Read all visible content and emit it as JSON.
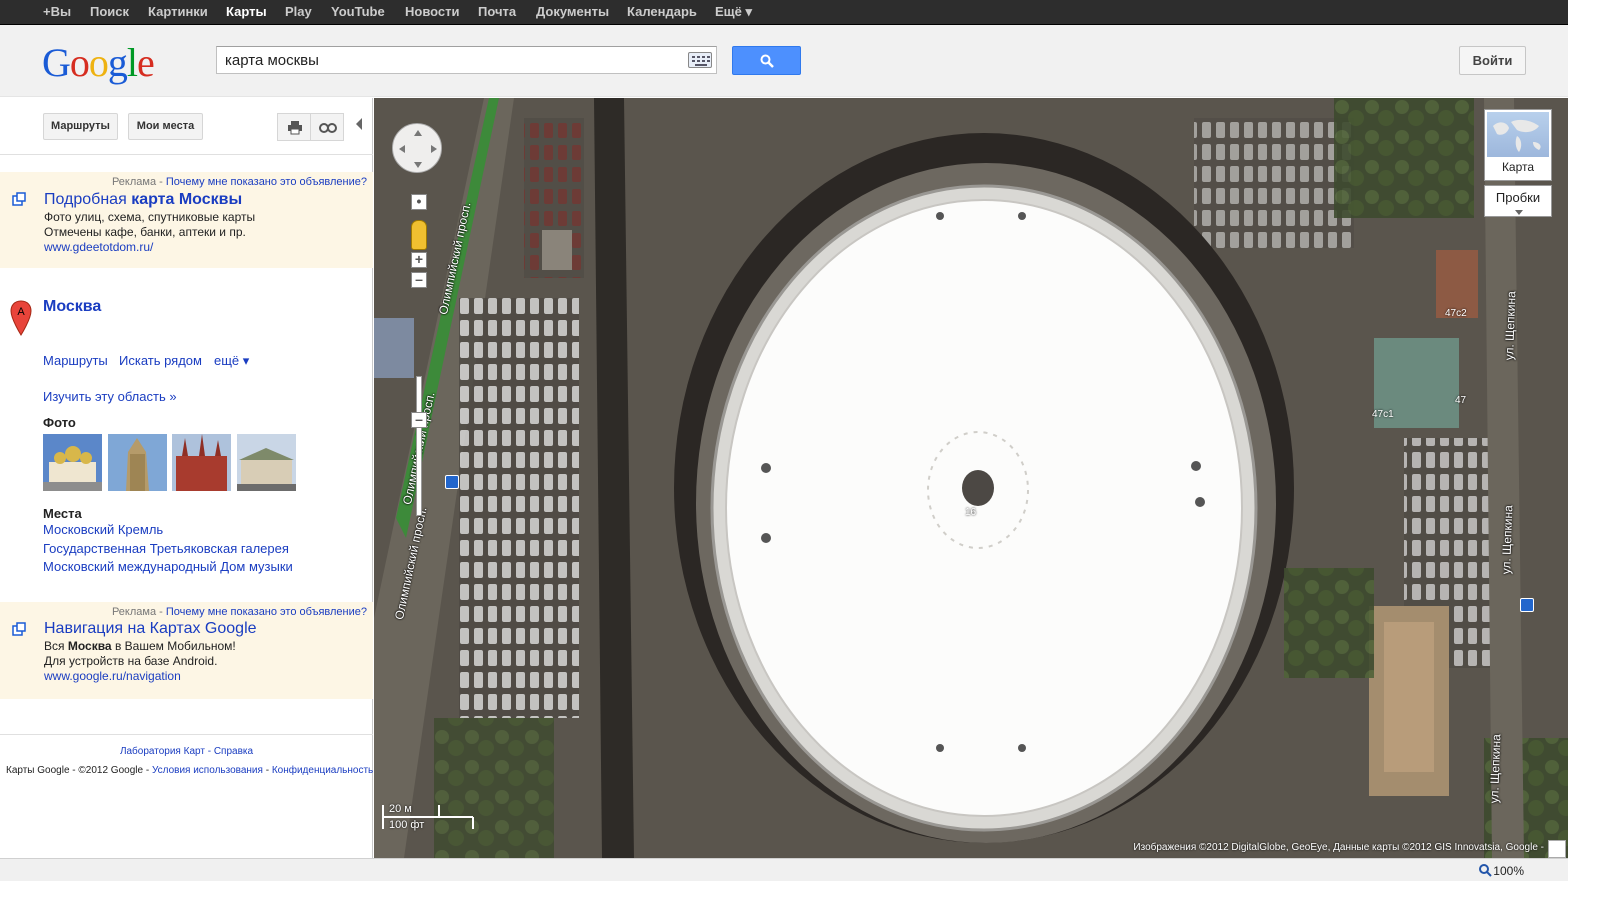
{
  "topnav": {
    "items": [
      "+Вы",
      "Поиск",
      "Картинки",
      "Карты",
      "Play",
      "YouTube",
      "Новости",
      "Почта",
      "Документы",
      "Календарь",
      "Ещё ▾"
    ],
    "active": "Карты"
  },
  "header": {
    "logo": "Google",
    "search_value": "карта москвы",
    "login_label": "Войти"
  },
  "left_panel": {
    "buttons": {
      "routes": "Маршруты",
      "my_places": "Мои места"
    },
    "ad1": {
      "label": "Реклама",
      "why": "Почему мне показано это объявление?",
      "title_plain": "Подробная",
      "title_bold": "карта Москвы",
      "line1": "Фото улиц, схема, спутниковые карты",
      "line2": "Отмечены кафе, банки, аптеки и пр.",
      "url": "www.gdeetotdom.ru/"
    },
    "result": {
      "pin_letter": "A",
      "title": "Москва",
      "links": [
        "Маршруты",
        "Искать рядом",
        "ещё ▾"
      ],
      "explore": "Изучить эту область »",
      "photos_heading": "Фото",
      "places_heading": "Места",
      "places": [
        "Московский Кремль",
        "Государственная Третьяковская галерея",
        "Московский международный Дом музыки"
      ]
    },
    "ad2": {
      "label": "Реклама",
      "why": "Почему мне показано это объявление?",
      "title": "Навигация на Картах Google",
      "line1_pre": "Вся",
      "line1_bold": "Москва",
      "line1_post": "в Вашем Мобильном!",
      "line2": "Для устройств на базе Android.",
      "url": "www.google.ru/navigation"
    },
    "footer": {
      "labs": "Лаборатория Карт",
      "sep": " - ",
      "help": "Справка",
      "copy": "Карты Google - ©2012 Google - ",
      "terms": "Условия использования",
      "privacy": "Конфиденциальность"
    }
  },
  "map": {
    "layer_label": "Карта",
    "traffic_label": "Пробки",
    "scale_metric": "20 м",
    "scale_imperial": "100 фт",
    "attribution": "Изображения ©2012 DigitalGlobe, GeoEye, Данные карты ©2012 GIS Innovatsia, Google -",
    "street_labels": [
      "Олимпийский просп.",
      "Олимпийский просп.",
      "Олимпийский просп.",
      "ул. Щепкина",
      "ул. Щепкина",
      "ул. Щепкина"
    ],
    "building_numbers": [
      "16",
      "47с2",
      "47с1",
      "47"
    ]
  },
  "statusbar": {
    "zoom": "100%"
  },
  "colors": {
    "accent": "#4d90fe",
    "link": "#1a3dc1",
    "ad_bg": "#fdf6e5",
    "topbar": "#2d2d2d"
  }
}
